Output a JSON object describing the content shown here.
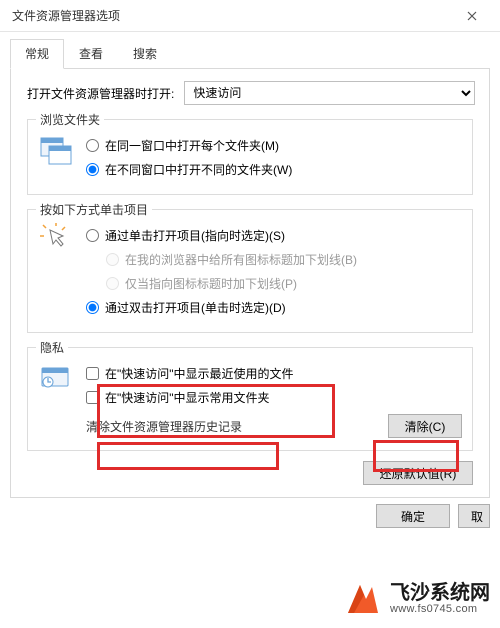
{
  "window": {
    "title": "文件资源管理器选项"
  },
  "tabs": [
    "常规",
    "查看",
    "搜索"
  ],
  "open_to": {
    "label": "打开文件资源管理器时打开:",
    "selected": "快速访问"
  },
  "browse_group": {
    "legend": "浏览文件夹",
    "options": [
      {
        "label": "在同一窗口中打开每个文件夹(M)",
        "checked": false
      },
      {
        "label": "在不同窗口中打开不同的文件夹(W)",
        "checked": true
      }
    ]
  },
  "click_group": {
    "legend": "按如下方式单击项目",
    "opt_single": "通过单击打开项目(指向时选定)(S)",
    "opt_underline_browser": "在我的浏览器中给所有图标标题加下划线(B)",
    "opt_underline_hover": "仅当指向图标标题时加下划线(P)",
    "opt_double": "通过双击打开项目(单击时选定)(D)"
  },
  "privacy_group": {
    "legend": "隐私",
    "cb_recent": "在\"快速访问\"中显示最近使用的文件",
    "cb_frequent": "在\"快速访问\"中显示常用文件夹",
    "clear_label": "清除文件资源管理器历史记录",
    "clear_btn": "清除(C)"
  },
  "restore_btn": "还原默认值(R)",
  "bottom": {
    "ok": "确定",
    "cancel_partial": "取"
  },
  "watermark": {
    "brand": "飞沙系统网",
    "url": "www.fs0745.com"
  },
  "colors": {
    "highlight": "#e02b2b"
  }
}
